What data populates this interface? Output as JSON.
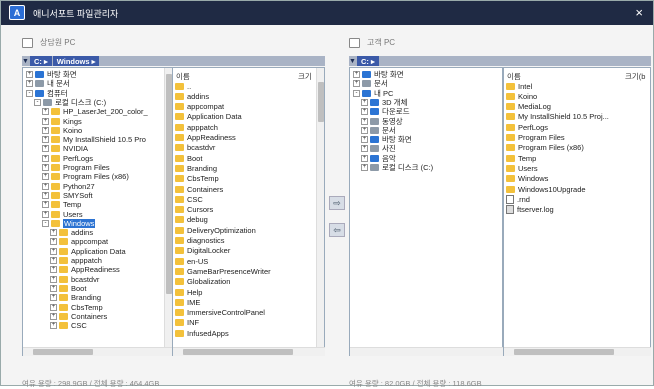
{
  "titlebar": {
    "logo": "A",
    "title": "애니서포트 파일관리자",
    "close": "×"
  },
  "left": {
    "header": "상담원 PC",
    "path": [
      "C:",
      "Windows"
    ],
    "tree": [
      {
        "label": "바탕 화면",
        "level": 0,
        "exp": "+",
        "icon": "blue"
      },
      {
        "label": "내 문서",
        "level": 0,
        "exp": "+",
        "icon": "gray"
      },
      {
        "label": "컴퓨터",
        "level": 0,
        "exp": "-",
        "icon": "blue"
      },
      {
        "label": "로컬 디스크 (C:)",
        "level": 1,
        "exp": "-",
        "icon": "gray"
      },
      {
        "label": "HP_LaserJet_200_color_",
        "level": 2,
        "exp": "+"
      },
      {
        "label": "Kings",
        "level": 2,
        "exp": "+"
      },
      {
        "label": "Koino",
        "level": 2,
        "exp": "+"
      },
      {
        "label": "My InstallShield 10.5 Pro",
        "level": 2,
        "exp": "+"
      },
      {
        "label": "NVIDIA",
        "level": 2,
        "exp": "+"
      },
      {
        "label": "PerfLogs",
        "level": 2,
        "exp": "+"
      },
      {
        "label": "Program Files",
        "level": 2,
        "exp": "+"
      },
      {
        "label": "Program Files (x86)",
        "level": 2,
        "exp": "+"
      },
      {
        "label": "Python27",
        "level": 2,
        "exp": "+"
      },
      {
        "label": "SMYSoft",
        "level": 2,
        "exp": "+"
      },
      {
        "label": "Temp",
        "level": 2,
        "exp": "+"
      },
      {
        "label": "Users",
        "level": 2,
        "exp": "+"
      },
      {
        "label": "Windows",
        "level": 2,
        "exp": "-",
        "selected": true
      },
      {
        "label": "addins",
        "level": 3,
        "exp": "+"
      },
      {
        "label": "appcompat",
        "level": 3,
        "exp": "+"
      },
      {
        "label": "Application Data",
        "level": 3,
        "exp": "+"
      },
      {
        "label": "apppatch",
        "level": 3,
        "exp": "+"
      },
      {
        "label": "AppReadiness",
        "level": 3,
        "exp": "+"
      },
      {
        "label": "bcastdvr",
        "level": 3,
        "exp": "+"
      },
      {
        "label": "Boot",
        "level": 3,
        "exp": "+"
      },
      {
        "label": "Branding",
        "level": 3,
        "exp": "+"
      },
      {
        "label": "CbsTemp",
        "level": 3,
        "exp": "+"
      },
      {
        "label": "Containers",
        "level": 3,
        "exp": "+"
      },
      {
        "label": "CSC",
        "level": 3,
        "exp": "+"
      }
    ],
    "list_header_name": "이름",
    "list_header_size": "크기",
    "list": [
      "..",
      "addins",
      "appcompat",
      "Application Data",
      "apppatch",
      "AppReadiness",
      "bcastdvr",
      "Boot",
      "Branding",
      "CbsTemp",
      "Containers",
      "CSC",
      "Cursors",
      "debug",
      "DeliveryOptimization",
      "diagnostics",
      "DigitalLocker",
      "en-US",
      "GameBarPresenceWriter",
      "Globalization",
      "Help",
      "IME",
      "ImmersiveControlPanel",
      "INF",
      "InfusedApps"
    ],
    "footer": "여유 용량 : 298.9GB / 전체 용량 : 464.4GB"
  },
  "transfer": {
    "to_right": "⇨",
    "to_left": "⇦"
  },
  "right": {
    "header": "고객 PC",
    "path": [
      "C:"
    ],
    "tree": [
      {
        "label": "바탕 화면",
        "level": 0,
        "exp": "+",
        "icon": "blue"
      },
      {
        "label": "문서",
        "level": 0,
        "exp": "+",
        "icon": "gray"
      },
      {
        "label": "내 PC",
        "level": 0,
        "exp": "-",
        "icon": "blue"
      },
      {
        "label": "3D 개체",
        "level": 1,
        "exp": "+",
        "icon": "blue"
      },
      {
        "label": "다운로드",
        "level": 1,
        "exp": "+",
        "icon": "blue"
      },
      {
        "label": "동영상",
        "level": 1,
        "exp": "+",
        "icon": "gray"
      },
      {
        "label": "문서",
        "level": 1,
        "exp": "+",
        "icon": "gray"
      },
      {
        "label": "바탕 화면",
        "level": 1,
        "exp": "+",
        "icon": "blue"
      },
      {
        "label": "사진",
        "level": 1,
        "exp": "+",
        "icon": "gray"
      },
      {
        "label": "음악",
        "level": 1,
        "exp": "+",
        "icon": "blue"
      },
      {
        "label": "로컬 디스크 (C:)",
        "level": 1,
        "exp": "+",
        "icon": "gray"
      }
    ],
    "list_header_name": "이름",
    "list_header_size": "크기(b",
    "list": [
      {
        "name": "Intel",
        "type": "folder"
      },
      {
        "name": "Koino",
        "type": "folder"
      },
      {
        "name": "MediaLog",
        "type": "folder"
      },
      {
        "name": "My InstallShield 10.5 Proj...",
        "type": "folder"
      },
      {
        "name": "PerfLogs",
        "type": "folder"
      },
      {
        "name": "Program Files",
        "type": "folder"
      },
      {
        "name": "Program Files (x86)",
        "type": "folder"
      },
      {
        "name": "Temp",
        "type": "folder"
      },
      {
        "name": "Users",
        "type": "folder"
      },
      {
        "name": "Windows",
        "type": "folder"
      },
      {
        "name": "Windows10Upgrade",
        "type": "folder"
      },
      {
        "name": ".rnd",
        "type": "file"
      },
      {
        "name": "ftserver.log",
        "type": "file-dark"
      }
    ],
    "footer": "여유 용량 : 82.0GB / 전체 용량 : 118.6GB"
  }
}
